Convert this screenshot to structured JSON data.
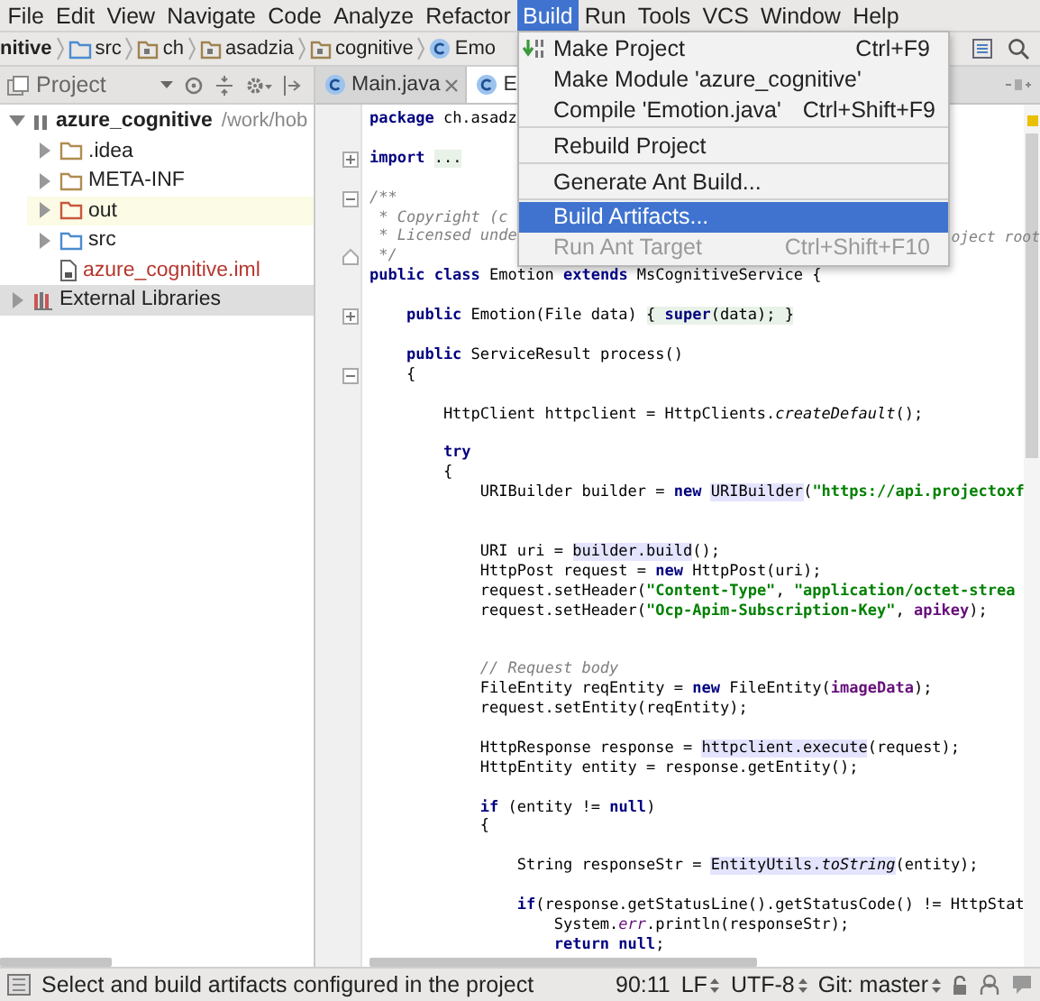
{
  "menu_bar": {
    "items": [
      {
        "label": "File",
        "selected": false
      },
      {
        "label": "Edit",
        "selected": false
      },
      {
        "label": "View",
        "selected": false
      },
      {
        "label": "Navigate",
        "selected": false
      },
      {
        "label": "Code",
        "selected": false
      },
      {
        "label": "Analyze",
        "selected": false
      },
      {
        "label": "Refactor",
        "selected": false
      },
      {
        "label": "Build",
        "selected": true
      },
      {
        "label": "Run",
        "selected": false
      },
      {
        "label": "Tools",
        "selected": false
      },
      {
        "label": "VCS",
        "selected": false
      },
      {
        "label": "Window",
        "selected": false
      },
      {
        "label": "Help",
        "selected": false
      }
    ]
  },
  "breadcrumbs": [
    {
      "label": "nitive",
      "kind": "module"
    },
    {
      "label": "src",
      "kind": "source-folder"
    },
    {
      "label": "ch",
      "kind": "package"
    },
    {
      "label": "asadzia",
      "kind": "package"
    },
    {
      "label": "cognitive",
      "kind": "package"
    },
    {
      "label": "Emo",
      "kind": "class"
    }
  ],
  "project_panel": {
    "title": "Project",
    "tree": [
      {
        "label": "azure_cognitive",
        "path": "/work/hob",
        "kind": "module",
        "expanded": true,
        "selected": false,
        "children": [
          {
            "label": ".idea",
            "kind": "folder",
            "expanded": false,
            "selected": false,
            "excluded": false
          },
          {
            "label": "META-INF",
            "kind": "folder",
            "expanded": false,
            "selected": false,
            "excluded": false
          },
          {
            "label": "out",
            "kind": "folder",
            "expanded": false,
            "selected": false,
            "excluded": true
          },
          {
            "label": "src",
            "kind": "source-folder",
            "expanded": false,
            "selected": false,
            "excluded": false
          },
          {
            "label": "azure_cognitive.iml",
            "kind": "file",
            "selected": false,
            "color": "#b5372e"
          }
        ]
      },
      {
        "label": "External Libraries",
        "kind": "library",
        "expanded": false,
        "selected": true
      }
    ]
  },
  "editor_tabs": [
    {
      "label": "Main.java",
      "selected": false,
      "closable": true
    },
    {
      "label": "E",
      "selected": true,
      "closable": false
    }
  ],
  "editor": {
    "blocks": [
      {
        "lines": [
          {
            "segments": [
              {
                "kind": "keyword",
                "text": "package"
              },
              {
                "kind": "plain",
                "text": " ch.asadz"
              }
            ]
          }
        ]
      },
      {
        "lines": [
          {
            "fold_start": true,
            "collapsed": true,
            "segments": [
              {
                "kind": "keyword",
                "text": "import "
              },
              {
                "kind": "folded",
                "text": "..."
              }
            ]
          }
        ]
      },
      {
        "lines": [
          {
            "fold_start": true,
            "collapsed": false,
            "segments": [
              {
                "kind": "comment",
                "text": "/**"
              }
            ]
          },
          {
            "segments": [
              {
                "kind": "comment",
                "text": " * Copyright (c"
              }
            ]
          },
          {
            "segments": [
              {
                "kind": "comment",
                "text": " * Licensed unde"
              }
            ],
            "tail": [
              {
                "kind": "comment",
                "text": "oject root"
              }
            ]
          },
          {
            "fold_end": true,
            "segments": [
              {
                "kind": "comment",
                "text": " */"
              }
            ]
          },
          {
            "segments": [
              {
                "kind": "keyword",
                "text": "public class"
              },
              {
                "kind": "plain",
                "text": " Emotion "
              },
              {
                "kind": "keyword",
                "text": "extends"
              },
              {
                "kind": "plain",
                "text": " MsCognitiveService {"
              }
            ]
          }
        ]
      },
      {
        "lines": [
          {
            "fold_start": true,
            "collapsed": true,
            "segments": [
              {
                "kind": "keyword",
                "text": "    public"
              },
              {
                "kind": "plain",
                "text": " Emotion(File data) "
              },
              {
                "kind": "folded",
                "text": "{ "
              },
              {
                "kind": "folded_keyword",
                "text": "super"
              },
              {
                "kind": "folded",
                "text": "(data); }"
              }
            ]
          }
        ]
      },
      {
        "lines": [
          {
            "segments": [
              {
                "kind": "keyword",
                "text": "    public"
              },
              {
                "kind": "plain",
                "text": " ServiceResult process()"
              }
            ]
          },
          {
            "fold_start": true,
            "collapsed": false,
            "segments": [
              {
                "kind": "plain",
                "text": "    {"
              }
            ]
          }
        ]
      },
      {
        "lines": [
          {
            "segments": [
              {
                "kind": "plain",
                "text": "        HttpClient httpclient = HttpClients."
              },
              {
                "kind": "static",
                "text": "createDefault"
              },
              {
                "kind": "plain",
                "text": "();"
              }
            ]
          }
        ]
      },
      {
        "wide_gap": true,
        "lines": [
          {
            "segments": [
              {
                "kind": "keyword",
                "text": "        try"
              }
            ]
          },
          {
            "segments": [
              {
                "kind": "plain",
                "text": "        {"
              }
            ]
          },
          {
            "segments": [
              {
                "kind": "plain",
                "text": "            URIBuilder builder = "
              },
              {
                "kind": "keyword",
                "text": "new "
              },
              {
                "kind": "usage",
                "text": "URIBuilder"
              },
              {
                "kind": "plain",
                "text": "("
              },
              {
                "kind": "string",
                "text": "\"https://api.projectoxf"
              }
            ]
          }
        ]
      },
      {
        "wide_gap": true,
        "lines": [
          {
            "segments": [
              {
                "kind": "plain",
                "text": "            URI uri = "
              },
              {
                "kind": "usage",
                "text": "builder.build"
              },
              {
                "kind": "plain",
                "text": "();"
              }
            ]
          },
          {
            "segments": [
              {
                "kind": "plain",
                "text": "            HttpPost request = "
              },
              {
                "kind": "keyword",
                "text": "new"
              },
              {
                "kind": "plain",
                "text": " HttpPost(uri);"
              }
            ]
          },
          {
            "segments": [
              {
                "kind": "plain",
                "text": "            request.setHeader("
              },
              {
                "kind": "string",
                "text": "\"Content-Type\""
              },
              {
                "kind": "plain",
                "text": ", "
              },
              {
                "kind": "string",
                "text": "\"application/octet-strea"
              }
            ]
          },
          {
            "segments": [
              {
                "kind": "plain",
                "text": "            request.setHeader("
              },
              {
                "kind": "string",
                "text": "\"Ocp-Apim-Subscription-Key\""
              },
              {
                "kind": "plain",
                "text": ", "
              },
              {
                "kind": "field",
                "text": "apikey"
              },
              {
                "kind": "plain",
                "text": ");"
              }
            ]
          }
        ]
      },
      {
        "lines": [
          {
            "segments": [
              {
                "kind": "comment",
                "text": "            // Request body"
              }
            ]
          },
          {
            "segments": [
              {
                "kind": "plain",
                "text": "            FileEntity reqEntity = "
              },
              {
                "kind": "keyword",
                "text": "new"
              },
              {
                "kind": "plain",
                "text": " FileEntity("
              },
              {
                "kind": "field",
                "text": "imageData"
              },
              {
                "kind": "plain",
                "text": ");"
              }
            ]
          },
          {
            "segments": [
              {
                "kind": "plain",
                "text": "            request.setEntity(reqEntity);"
              }
            ]
          }
        ]
      },
      {
        "lines": [
          {
            "segments": [
              {
                "kind": "plain",
                "text": "            HttpResponse response = "
              },
              {
                "kind": "usage",
                "text": "httpclient.execute"
              },
              {
                "kind": "plain",
                "text": "(request);"
              }
            ]
          },
          {
            "segments": [
              {
                "kind": "plain",
                "text": "            HttpEntity entity = response.getEntity();"
              }
            ]
          }
        ]
      },
      {
        "lines": [
          {
            "segments": [
              {
                "kind": "keyword",
                "text": "            if"
              },
              {
                "kind": "plain",
                "text": " (entity != "
              },
              {
                "kind": "keyword",
                "text": "null"
              },
              {
                "kind": "plain",
                "text": ")"
              }
            ]
          },
          {
            "segments": [
              {
                "kind": "plain",
                "text": "            {"
              }
            ]
          }
        ]
      },
      {
        "lines": [
          {
            "segments": [
              {
                "kind": "plain",
                "text": "                String responseStr = "
              },
              {
                "kind": "usage",
                "text": "EntityUtils."
              },
              {
                "kind": "usage_static",
                "text": "toString"
              },
              {
                "kind": "plain",
                "text": "(entity);"
              }
            ]
          }
        ]
      },
      {
        "lines": [
          {
            "segments": [
              {
                "kind": "keyword",
                "text": "                if"
              },
              {
                "kind": "plain",
                "text": "(response.getStatusLine().getStatusCode() != HttpStat"
              }
            ]
          },
          {
            "segments": [
              {
                "kind": "plain",
                "text": "                    System."
              },
              {
                "kind": "field_static",
                "text": "err"
              },
              {
                "kind": "plain",
                "text": ".println(responseStr);"
              }
            ]
          },
          {
            "segments": [
              {
                "kind": "keyword",
                "text": "                    return null"
              },
              {
                "kind": "plain",
                "text": ";"
              }
            ]
          }
        ]
      }
    ]
  },
  "build_menu": {
    "items": [
      {
        "kind": "item",
        "label": "Make Project",
        "shortcut": "Ctrl+F9",
        "has_icon": true,
        "selected": false,
        "disabled": false
      },
      {
        "kind": "item",
        "label": "Make Module 'azure_cognitive'",
        "selected": false,
        "disabled": false
      },
      {
        "kind": "item",
        "label": "Compile 'Emotion.java'",
        "shortcut": "Ctrl+Shift+F9",
        "selected": false,
        "disabled": false
      },
      {
        "kind": "separator"
      },
      {
        "kind": "item",
        "label": "Rebuild Project",
        "selected": false,
        "disabled": false
      },
      {
        "kind": "separator"
      },
      {
        "kind": "item",
        "label": "Generate Ant Build...",
        "selected": false,
        "disabled": false
      },
      {
        "kind": "separator"
      },
      {
        "kind": "item",
        "label": "Build Artifacts...",
        "selected": true,
        "disabled": false
      },
      {
        "kind": "item",
        "label": "Run Ant Target",
        "shortcut": "Ctrl+Shift+F10",
        "selected": false,
        "disabled": true
      }
    ]
  },
  "status_bar": {
    "message": "Select and build artifacts configured in the project",
    "position": "90:11",
    "line_separator": "LF",
    "encoding": "UTF-8",
    "vcs_branch": "Git: master"
  }
}
